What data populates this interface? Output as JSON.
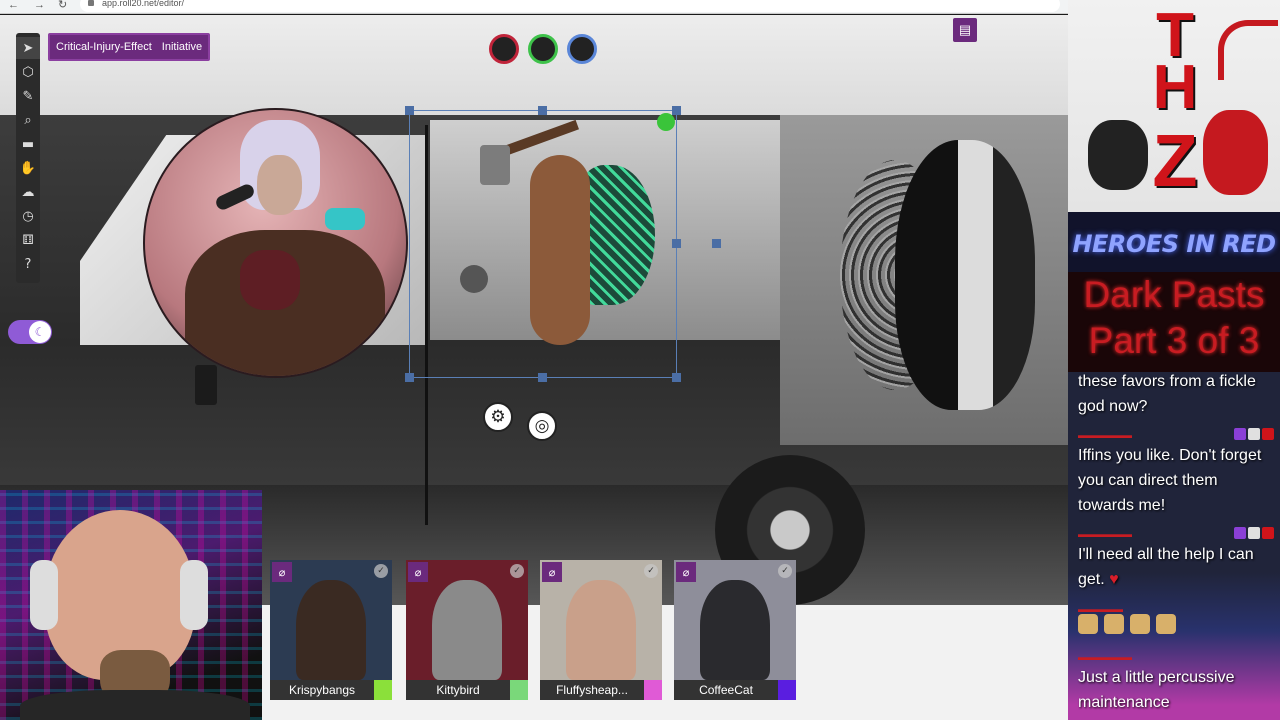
{
  "browser": {
    "url": "app.roll20.net/editor/"
  },
  "toolbar": {
    "layer_label": "Critical-Injury-Effect",
    "initiative_label": "Initiative",
    "tools": [
      {
        "name": "select-tool",
        "glyph": "➤"
      },
      {
        "name": "shapes-tool",
        "glyph": "⬡"
      },
      {
        "name": "draw-tool",
        "glyph": "✎"
      },
      {
        "name": "zoom-tool",
        "glyph": "⌕"
      },
      {
        "name": "measure-tool",
        "glyph": "▬"
      },
      {
        "name": "pan-tool",
        "glyph": "✋"
      },
      {
        "name": "fog-tool",
        "glyph": "☁"
      },
      {
        "name": "turn-tracker-tool",
        "glyph": "◷"
      },
      {
        "name": "dice-tool",
        "glyph": "⚅"
      },
      {
        "name": "help-tool",
        "glyph": "?"
      }
    ]
  },
  "color_dots": [
    {
      "name": "red-status-dot",
      "ring": "#c0243a"
    },
    {
      "name": "green-status-dot",
      "ring": "#3ec24a"
    },
    {
      "name": "blue-status-dot",
      "ring": "#5a86d8"
    }
  ],
  "token_controls": {
    "gear_icon": "⚙",
    "target_icon": "◎"
  },
  "players": [
    {
      "name": "Krispybangs",
      "color": "#8be03a",
      "bg": "#2c3b52",
      "fig": "#3a2a22"
    },
    {
      "name": "Kittybird",
      "color": "#7ad87a",
      "bg": "#6a1e2a",
      "fig": "#8a8a8a"
    },
    {
      "name": "Fluffysheap...",
      "color": "#e05ad6",
      "bg": "#b8b2a8",
      "fig": "#c9a08a"
    },
    {
      "name": "CoffeeCat",
      "color": "#5a1ee0",
      "bg": "#8e8e9a",
      "fig": "#2a2a2e"
    }
  ],
  "stream": {
    "logo_letters": [
      "T",
      "H",
      "Z"
    ],
    "title_line": "HEROES IN RED",
    "episode_line1": "Dark Pasts",
    "episode_line2": "Part 3 of 3"
  },
  "chat": [
    {
      "text": "these favors from a fickle god now?"
    },
    {
      "text": "Iffins you like. Don't forget you can direct them towards me!"
    },
    {
      "text": "I'll need all the help I can get."
    },
    {
      "text": "Just a little percussive maintenance"
    }
  ]
}
